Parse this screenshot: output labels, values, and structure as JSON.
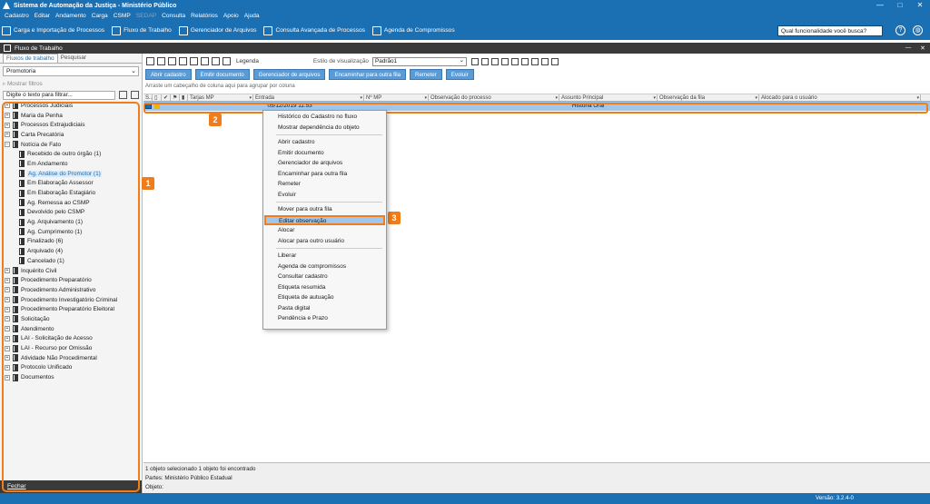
{
  "window": {
    "title": "Sistema de Automação da Justiça - Ministério Público",
    "controls": [
      "—",
      "□",
      "✕"
    ]
  },
  "menu": {
    "items": [
      "Cadastro",
      "Editar",
      "Andamento",
      "Carga",
      "CSMP",
      "SEDAP",
      "Consulta",
      "Relatórios",
      "Apoio",
      "Ajuda"
    ]
  },
  "toolbar": {
    "items": [
      "Carga e Importação de Processos",
      "Fluxo de Trabalho",
      "Gerenciador de Arquivos",
      "Consulta Avançada de Processos",
      "Agenda de Compromissos"
    ],
    "search_value": "Qual funcionalidade você busca?"
  },
  "subwindow": {
    "title": "Fluxo de Trabalho",
    "controls": [
      "—",
      "✕"
    ]
  },
  "left": {
    "tabs": [
      "Fluxos de trabalho",
      "Pesquisar"
    ],
    "select_value": "Promotoria",
    "mostrar_filtros": "Mostrar filtros",
    "filter_placeholder": "Digite o texto para filtrar...",
    "tree_top": [
      "Processos Judiciais",
      "Maria da Penha",
      "Processos Extrajudiciais",
      "Carta Precatória",
      "Notícia de Fato"
    ],
    "tree_children": [
      "Recebido de outro órgão (1)",
      "Em Andamento",
      "Ag. Análise do Promotor (1)",
      "Em Elaboração Assessor",
      "Em Elaboração Estagiário",
      "Ag. Remessa ao CSMP",
      "Devolvido pelo CSMP",
      "Ag. Arquivamento (1)",
      "Ag. Cumprimento (1)",
      "Finalizado (6)",
      "Arquivado (4)",
      "Cancelado (1)"
    ],
    "tree_bottom": [
      "Inquérito Civil",
      "Procedimento Preparatório",
      "Procedimento Administrativo",
      "Procedimento Investigatório Criminal",
      "Procedimento Preparatório Eleitoral",
      "Solicitação",
      "Atendimento",
      "LAI - Solicitação de Acesso",
      "LAI - Recurso por Omissão",
      "Atividade Não Procedimental",
      "Protocolo Unificado",
      "Documentos"
    ],
    "fechar": "Fechar"
  },
  "right": {
    "legenda": "Legenda",
    "estilo_label": "Estilo de visualização",
    "estilo_value": "Padrão1",
    "actions": [
      "Abrir cadastro",
      "Emitir documento",
      "Gerenciador de arquivos",
      "Encaminhar para outra fila",
      "Remeter",
      "Evoluir"
    ],
    "group_hint": "Arraste um cabeçalho de coluna aqui para agrupar por coluna",
    "columns": [
      "S...",
      "Tarjas MP",
      "Entrada",
      "Nº MP",
      "Observação do processo",
      "Assunto Principal",
      "Observação da fila",
      "Alocado para o usuário"
    ],
    "row": {
      "entrada": "05/12/2019 11:53",
      "assunto": "História Oral"
    }
  },
  "context_menu": {
    "group1": [
      "Histórico do Cadastro no fluxo",
      "Mostrar dependência do objeto"
    ],
    "group2": [
      "Abrir cadastro",
      "Emitir documento",
      "Gerenciador de arquivos",
      "Encaminhar para outra fila",
      "Remeter",
      "Evoluir"
    ],
    "group3": [
      "Mover para outra fila",
      "Editar observação",
      "Alocar",
      "Alocar para outro usuário"
    ],
    "group4": [
      "Liberar",
      "Agenda de compromissos",
      "Consultar cadastro",
      "Etiqueta resumida",
      "Etiqueta de autuação",
      "Pasta digital",
      "Pendência e Prazo"
    ]
  },
  "status": {
    "line1": "1 objeto selecionado     1 objeto foi encontrado",
    "line2": "Partes: Ministério Público Estadual",
    "line3": "Objeto:",
    "version": "Versão: 3.2.4-0"
  },
  "badges": [
    "1",
    "2",
    "3"
  ],
  "colors": {
    "brand_blue": "#1b6fb3",
    "highlight_orange": "#f07d1a",
    "row_selected": "#9fc6ec"
  }
}
